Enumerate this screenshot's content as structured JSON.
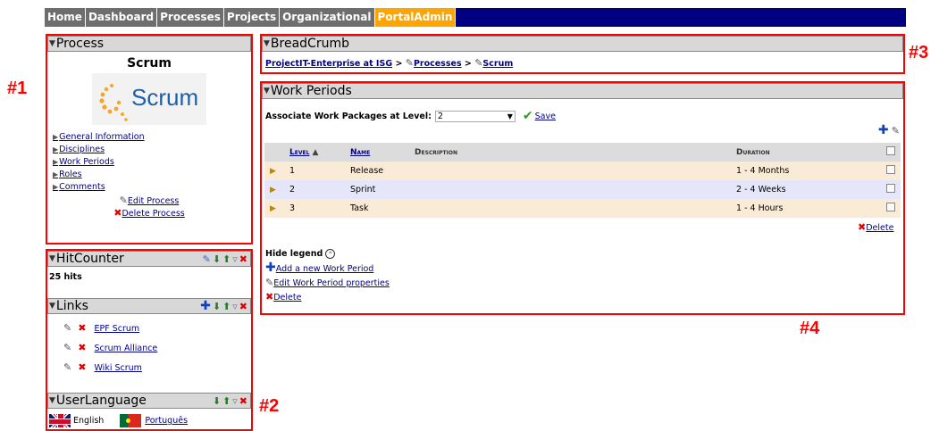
{
  "nav": {
    "tabs": [
      {
        "label": "Home"
      },
      {
        "label": "Dashboard"
      },
      {
        "label": "Processes"
      },
      {
        "label": "Projects"
      },
      {
        "label": "Organizational"
      },
      {
        "label": "PortalAdmin"
      }
    ]
  },
  "process": {
    "header": "Process",
    "name": "Scrum",
    "logo_text": "Scrum",
    "links": [
      "General Information",
      "Disciplines",
      "Work Periods",
      "Roles",
      "Comments"
    ],
    "edit": "Edit Process",
    "delete": "Delete Process"
  },
  "hitcounter": {
    "header": "HitCounter",
    "value": "25 hits"
  },
  "links_panel": {
    "header": "Links",
    "items": [
      "EPF Scrum",
      "Scrum Alliance",
      "Wiki Scrum"
    ]
  },
  "userlang": {
    "header": "UserLanguage",
    "english": "English",
    "portuguese": "Português"
  },
  "breadcrumb": {
    "header": "BreadCrumb",
    "root": "ProjectIT-Enterprise at ISG",
    "sep": ">",
    "processes": "Processes",
    "scrum": "Scrum"
  },
  "workperiods": {
    "header": "Work Periods",
    "assoc_label": "Associate Work Packages at Level:",
    "assoc_value": "2",
    "save": "Save",
    "columns": {
      "level": "Level",
      "name": "Name",
      "description": "Description",
      "duration": "Duration"
    },
    "rows": [
      {
        "level": "1",
        "name": "Release",
        "description": "",
        "duration": "1 - 4 Months"
      },
      {
        "level": "2",
        "name": "Sprint",
        "description": "",
        "duration": "2 - 4 Weeks"
      },
      {
        "level": "3",
        "name": "Task",
        "description": "",
        "duration": "1 - 4 Hours"
      }
    ],
    "delete": "Delete",
    "legend": "Hide legend",
    "add": "Add a new Work Period",
    "edit": "Edit Work Period properties",
    "legend_delete": "Delete"
  },
  "annotations": [
    "#1",
    "#2",
    "#3",
    "#4"
  ],
  "colors": {
    "nav_bg": "#000080",
    "tab_bg": "#6e6e6e",
    "active_tab": "#ffa500",
    "row_odd": "#faebd7",
    "row_even": "#e6e6fa",
    "highlight": "#ff0000"
  }
}
